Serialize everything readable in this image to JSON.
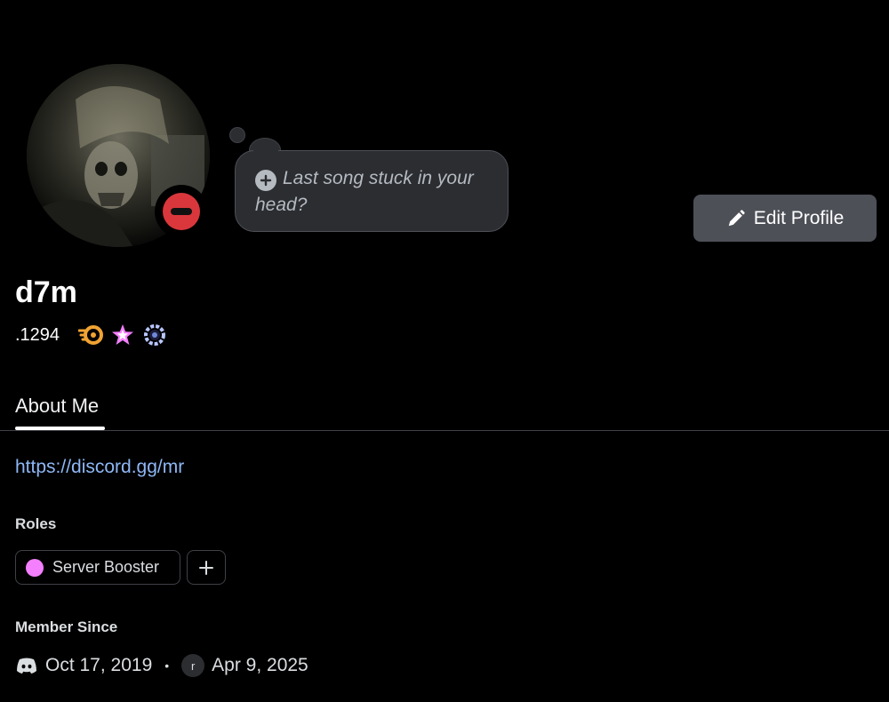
{
  "profile": {
    "username": "d7m",
    "discriminator": ".1294",
    "status": "dnd",
    "badges": [
      {
        "name": "nitro-boost-badge",
        "color": "#f0a332"
      },
      {
        "name": "star-badge",
        "color": "#f47fff"
      },
      {
        "name": "laurel-badge",
        "color": "#7289da"
      }
    ]
  },
  "custom_status": {
    "placeholder": "Last song stuck in your head?"
  },
  "actions": {
    "edit_profile_label": "Edit Profile"
  },
  "tabs": [
    {
      "label": "About Me",
      "active": true
    }
  ],
  "about": {
    "link": "https://discord.gg/mr"
  },
  "roles": {
    "title": "Roles",
    "items": [
      {
        "label": "Server Booster",
        "color": "#f47fff"
      }
    ]
  },
  "member_since": {
    "title": "Member Since",
    "discord_date": "Oct 17, 2019",
    "separator": "•",
    "server_initial": "r",
    "server_date": "Apr 9, 2025"
  },
  "colors": {
    "background": "#000000",
    "button": "#4e5058",
    "link": "#8eb7f5",
    "dnd": "#da373c"
  }
}
